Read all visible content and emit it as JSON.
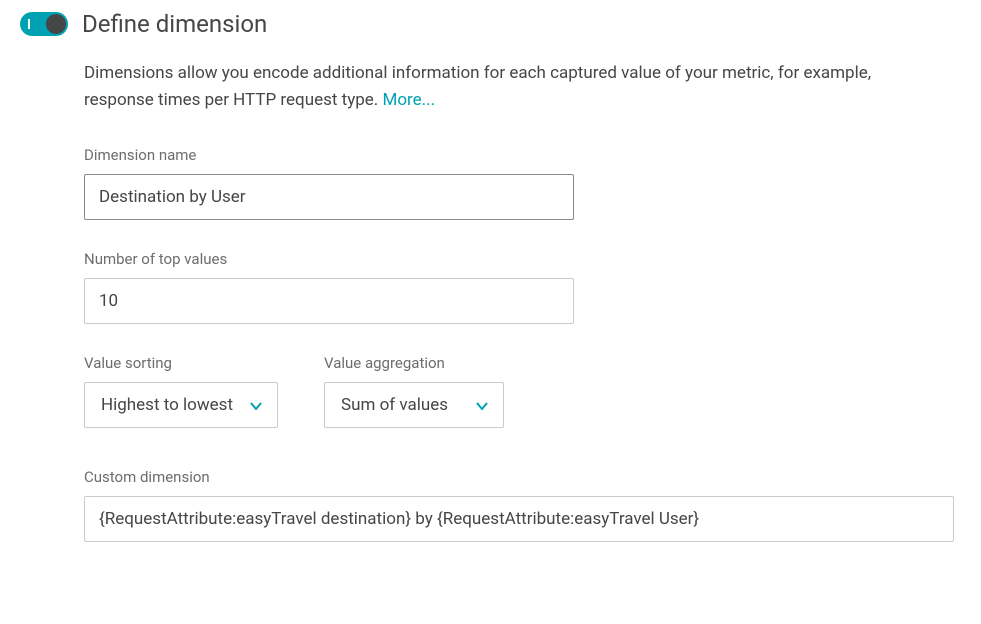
{
  "header": {
    "title": "Define dimension",
    "toggle_on": true
  },
  "description": {
    "text": "Dimensions allow you encode additional information for each captured value of your metric, for example, response times per HTTP request type. ",
    "more_label": "More..."
  },
  "fields": {
    "dimension_name": {
      "label": "Dimension name",
      "value": "Destination by User"
    },
    "top_values": {
      "label": "Number of top values",
      "value": "10"
    },
    "value_sorting": {
      "label": "Value sorting",
      "selected": "Highest to lowest"
    },
    "value_aggregation": {
      "label": "Value aggregation",
      "selected": "Sum of values"
    },
    "custom_dimension": {
      "label": "Custom dimension",
      "value": "{RequestAttribute:easyTravel destination} by {RequestAttribute:easyTravel User}"
    }
  }
}
